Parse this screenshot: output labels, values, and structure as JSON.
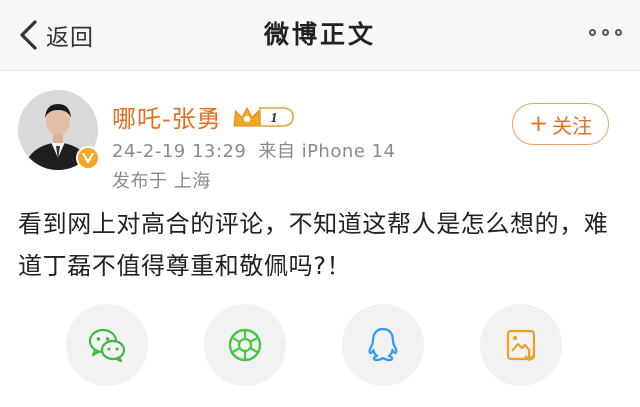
{
  "nav": {
    "back_label": "返回",
    "title": "微博正文",
    "back_icon": "chevron-left-icon",
    "more_icon": "more-dots-icon"
  },
  "author": {
    "name": "哪吒-张勇",
    "level": "1",
    "verified_icon": "verified-v-icon",
    "crown_icon": "crown-icon"
  },
  "post": {
    "datetime": "24-2-19 13:29",
    "source": "来自 iPhone 14",
    "location": "发布于 上海",
    "text": "看到网上对高合的评论，不知道这帮人是怎么想的，难道丁磊不值得尊重和敬佩吗?！"
  },
  "follow": {
    "plus": "+",
    "label": "关注"
  },
  "share": {
    "items": [
      {
        "icon": "wechat-icon"
      },
      {
        "icon": "moments-icon"
      },
      {
        "icon": "qq-icon"
      },
      {
        "icon": "save-image-icon"
      }
    ]
  },
  "colors": {
    "accent": "#eb6c1c",
    "follow_text": "#e8711e",
    "meta_text": "#8a8a8a",
    "wechat": "#3cba3c",
    "moments": "#43c843",
    "qq": "#2b9cf2",
    "save_image": "#f0a020"
  }
}
